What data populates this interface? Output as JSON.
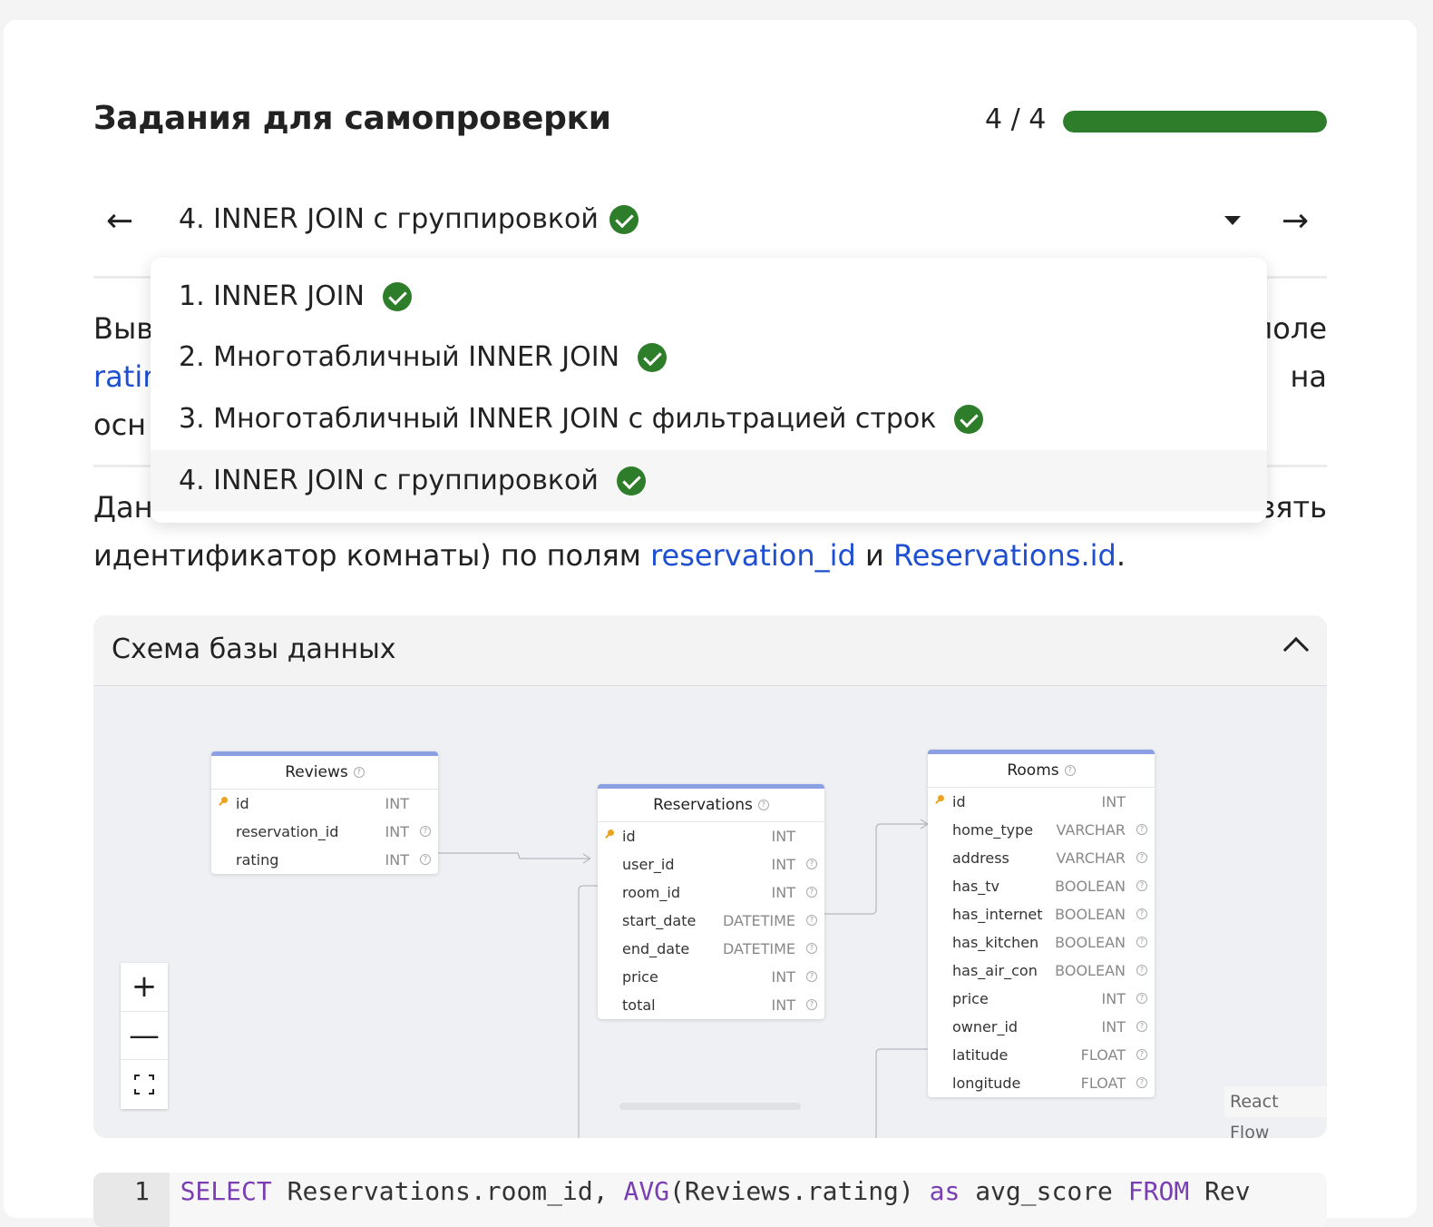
{
  "header": {
    "title": "Задания для самопроверки",
    "counter": "4 / 4",
    "progress_fraction": 1.0,
    "progress_color": "#2e7d2a"
  },
  "nav": {
    "prev_label": "←",
    "next_label": "→",
    "current": "4. INNER JOIN с группировкой"
  },
  "dropdown": {
    "items": [
      {
        "label": "1. INNER JOIN",
        "done": true
      },
      {
        "label": "2. Многотабличный INNER JOIN",
        "done": true
      },
      {
        "label": "3. Многотабличный INNER JOIN с фильтрацией строк",
        "done": true
      },
      {
        "label": "4. INNER JOIN с группировкой",
        "done": true
      }
    ],
    "selected_index": 3
  },
  "task_text": {
    "visible_left": [
      "Выв",
      "ratir",
      "осн"
    ],
    "visible_right": [
      "поле",
      "на"
    ]
  },
  "data_text": {
    "line1_left": "Дан",
    "line1_right": "зять",
    "line2_prefix": "идентификатор комнаты) по полям ",
    "link1": "reservation_id",
    "middle": " и ",
    "link2": "Reservations.id",
    "suffix": "."
  },
  "schema": {
    "title": "Схема базы данных",
    "tables": {
      "reviews": {
        "name": "Reviews",
        "columns": [
          {
            "name": "id",
            "type": "INT"
          },
          {
            "name": "reservation_id",
            "type": "INT"
          },
          {
            "name": "rating",
            "type": "INT"
          }
        ]
      },
      "reservations": {
        "name": "Reservations",
        "columns": [
          {
            "name": "id",
            "type": "INT"
          },
          {
            "name": "user_id",
            "type": "INT"
          },
          {
            "name": "room_id",
            "type": "INT"
          },
          {
            "name": "start_date",
            "type": "DATETIME"
          },
          {
            "name": "end_date",
            "type": "DATETIME"
          },
          {
            "name": "price",
            "type": "INT"
          },
          {
            "name": "total",
            "type": "INT"
          }
        ]
      },
      "rooms": {
        "name": "Rooms",
        "columns": [
          {
            "name": "id",
            "type": "INT"
          },
          {
            "name": "home_type",
            "type": "VARCHAR"
          },
          {
            "name": "address",
            "type": "VARCHAR"
          },
          {
            "name": "has_tv",
            "type": "BOOLEAN"
          },
          {
            "name": "has_internet",
            "type": "BOOLEAN"
          },
          {
            "name": "has_kitchen",
            "type": "BOOLEAN"
          },
          {
            "name": "has_air_con",
            "type": "BOOLEAN"
          },
          {
            "name": "price",
            "type": "INT"
          },
          {
            "name": "owner_id",
            "type": "INT"
          },
          {
            "name": "latitude",
            "type": "FLOAT"
          },
          {
            "name": "longitude",
            "type": "FLOAT"
          }
        ]
      }
    },
    "controls": {
      "zoom_in": "+",
      "zoom_out": "—"
    },
    "attribution": "React Flow"
  },
  "code": {
    "line_number": "1",
    "kw_select": "SELECT",
    "part1": " Reservations.room_id, ",
    "kw_avg": "AVG",
    "part2": "(Reviews.rating) ",
    "kw_as": "as",
    "part3": " avg_score ",
    "kw_from": "FROM",
    "part4": " Rev"
  }
}
